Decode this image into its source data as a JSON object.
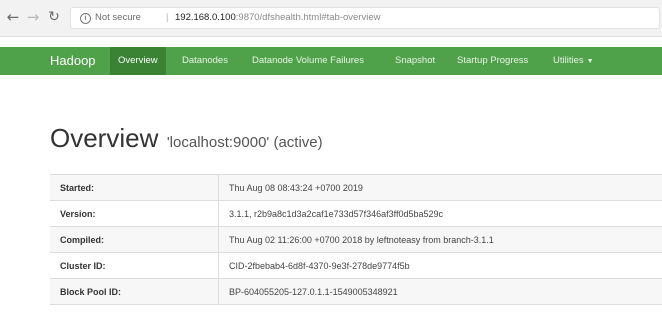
{
  "browser": {
    "back_icon": "arrow-left-icon",
    "forward_icon": "arrow-right-icon",
    "reload_icon": "reload-icon",
    "info_icon": "info-icon",
    "security_label": "Not secure",
    "separator": "|",
    "url_host": "192.168.0.100",
    "url_rest": ":9870/dfshealth.html#tab-overview"
  },
  "navbar": {
    "brand": "Hadoop",
    "items": [
      {
        "label": "Overview",
        "active": true
      },
      {
        "label": "Datanodes"
      },
      {
        "label": "Datanode Volume Failures"
      },
      {
        "label": "Snapshot"
      },
      {
        "label": "Startup Progress"
      },
      {
        "label": "Utilities"
      }
    ],
    "utilities_caret_icon": "caret-down-icon"
  },
  "heading": {
    "title": "Overview",
    "subtitle": "'localhost:9000' (active)"
  },
  "overview_table": [
    {
      "key": "Started:",
      "value": "Thu Aug 08 08:43:24 +0700 2019"
    },
    {
      "key": "Version:",
      "value": "3.1.1, r2b9a8c1d3a2caf1e733d57f346af3ff0d5ba529c"
    },
    {
      "key": "Compiled:",
      "value": "Thu Aug 02 11:26:00 +0700 2018 by leftnoteasy from branch-3.1.1"
    },
    {
      "key": "Cluster ID:",
      "value": "CID-2fbebab4-6d8f-4370-9e3f-278de9774f5b"
    },
    {
      "key": "Block Pool ID:",
      "value": "BP-604055205-127.0.1.1-1549005348921"
    }
  ],
  "colors": {
    "navbar": "#4fa14a",
    "navbar_active": "#3a8335"
  }
}
